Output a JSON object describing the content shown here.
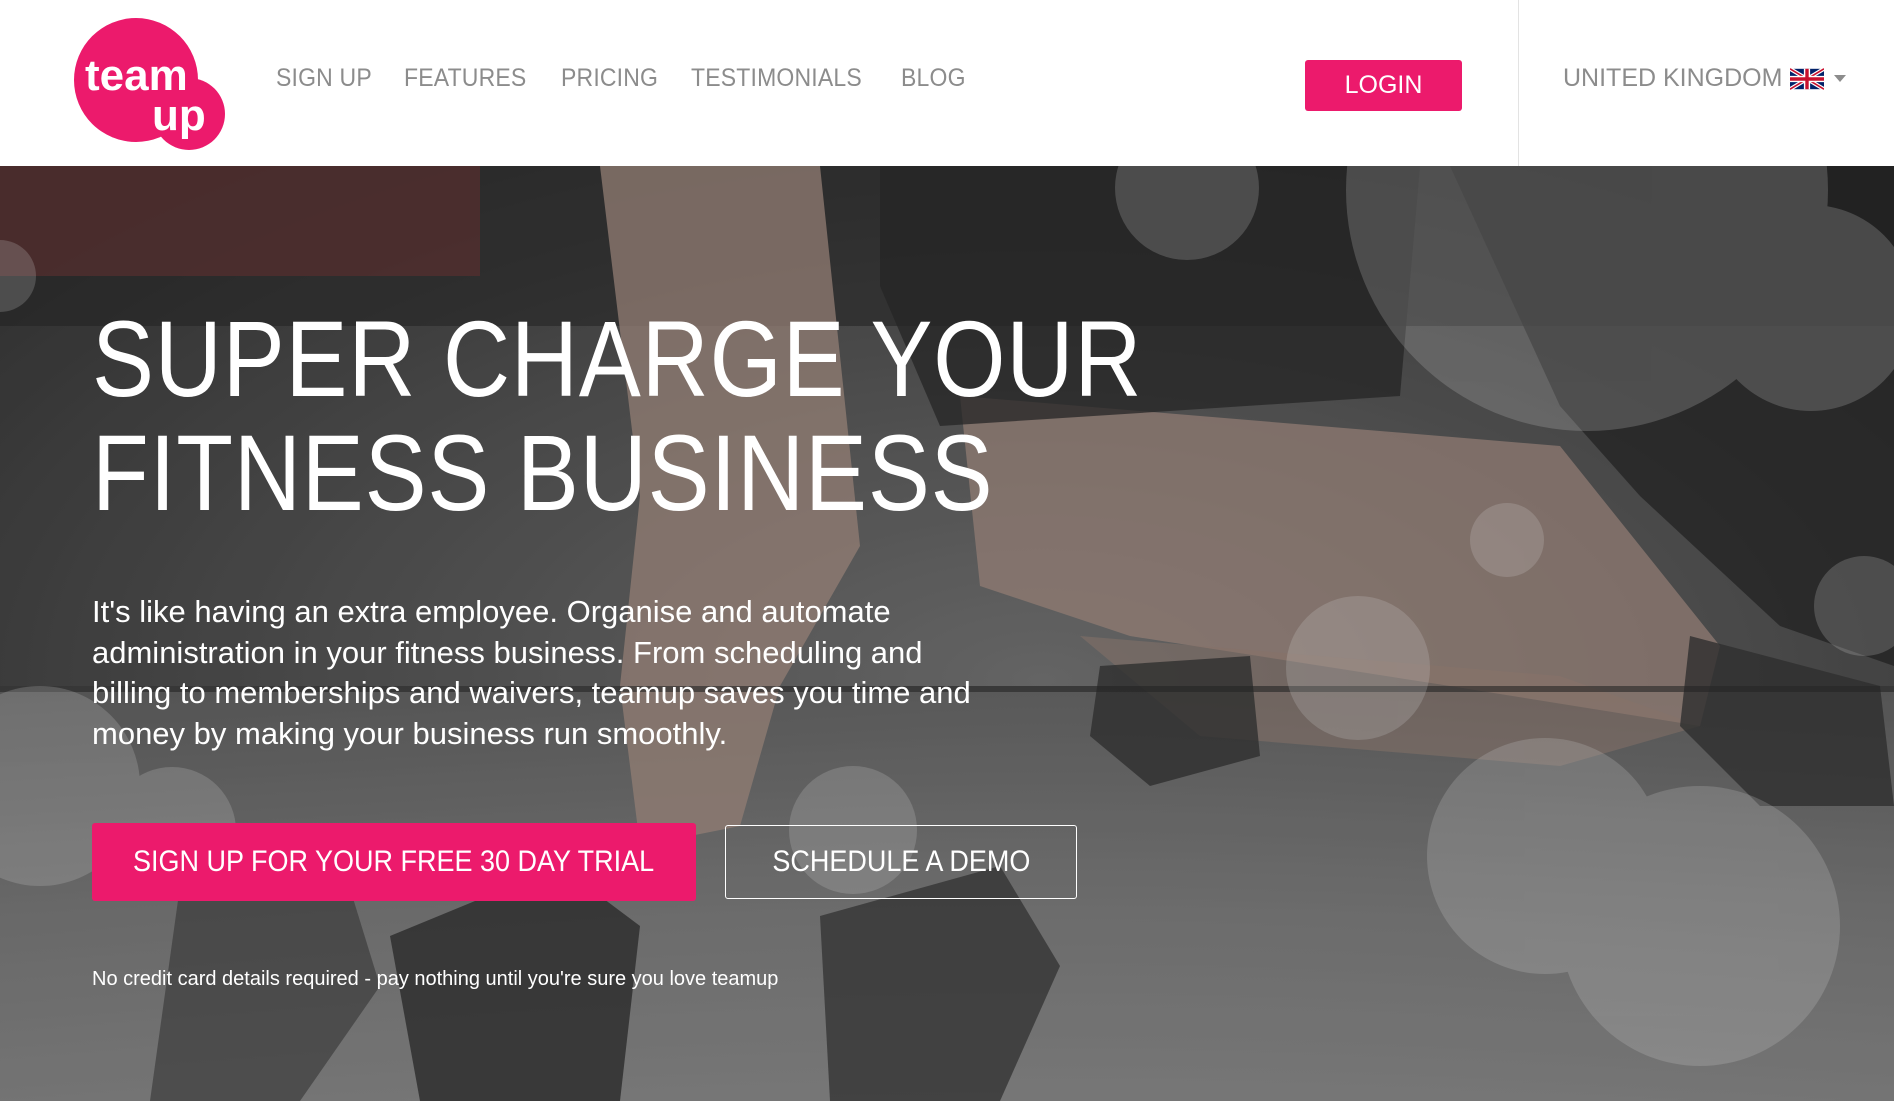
{
  "brand": {
    "logo_line1": "team",
    "logo_line2": "up",
    "accent_color": "#ec1a6c"
  },
  "nav": {
    "items": [
      {
        "label": "SIGN UP"
      },
      {
        "label": "FEATURES"
      },
      {
        "label": "PRICING"
      },
      {
        "label": "TESTIMONIALS"
      },
      {
        "label": "BLOG"
      }
    ],
    "login_label": "LOGIN",
    "country_label": "UNITED KINGDOM",
    "country_flag_icon": "uk-flag-icon",
    "country_caret_icon": "caret-down-icon"
  },
  "hero": {
    "title_line1": "SUPER CHARGE YOUR",
    "title_line2": "FITNESS BUSINESS",
    "description": "It's like having an extra employee. Organise and automate administration in your fitness business. From scheduling and billing to memberships and waivers, teamup saves you time and money by making your business run smoothly.",
    "cta_primary": "SIGN UP FOR YOUR FREE 30 DAY TRIAL",
    "cta_secondary": "SCHEDULE A DEMO",
    "fine_print": "No credit card details required - pay nothing until you're sure you love teamup"
  }
}
